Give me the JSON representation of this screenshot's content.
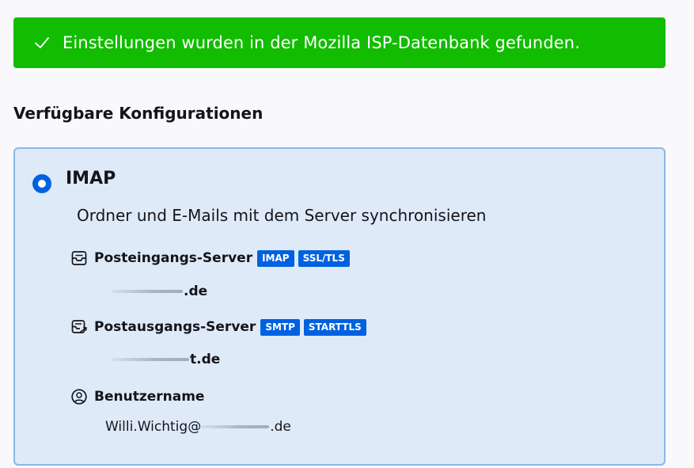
{
  "banner": {
    "message": "Einstellungen wurden in der Mozilla ISP-Datenbank gefunden.",
    "icon": "checkmark-icon",
    "color": "#12bc00"
  },
  "section": {
    "title": "Verfügbare Konfigurationen"
  },
  "config": {
    "protocol": "IMAP",
    "description": "Ordner und E-Mails mit dem Server synchronisieren",
    "selected": true,
    "accent_color": "#0061e0",
    "incoming": {
      "label": "Posteingangs-Server",
      "tags": [
        "IMAP",
        "SSL/TLS"
      ],
      "host_suffix": ".de",
      "icon": "inbox-icon"
    },
    "outgoing": {
      "label": "Postausgangs-Server",
      "tags": [
        "SMTP",
        "STARTTLS"
      ],
      "host_suffix": "t.de",
      "icon": "outbox-icon"
    },
    "username": {
      "label": "Benutzername",
      "value_prefix": "Willi.Wichtig@",
      "value_suffix": ".de",
      "icon": "at-sign-icon"
    }
  }
}
